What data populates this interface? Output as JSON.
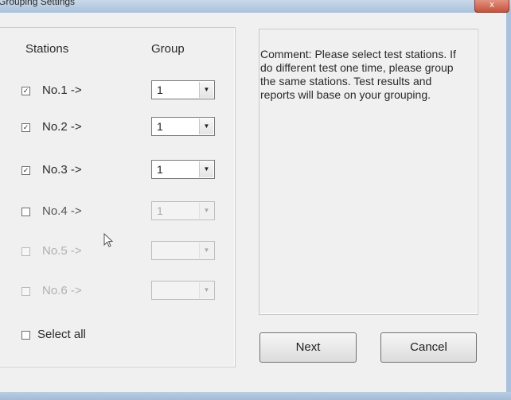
{
  "window": {
    "title": "Grouping Settings",
    "close_glyph": "x"
  },
  "headers": {
    "stations": "Stations",
    "group": "Group"
  },
  "stations": [
    {
      "label": "No.1 ->",
      "checked": true,
      "check_glyph": "✓",
      "group": "1",
      "enabled": true
    },
    {
      "label": "No.2 ->",
      "checked": true,
      "check_glyph": "✓",
      "group": "1",
      "enabled": true
    },
    {
      "label": "No.3 ->",
      "checked": true,
      "check_glyph": "✓",
      "group": "1",
      "enabled": true
    },
    {
      "label": "No.4 ->",
      "checked": false,
      "check_glyph": "",
      "group": "1",
      "enabled": false
    },
    {
      "label": "No.5 ->",
      "checked": false,
      "check_glyph": "",
      "group": "",
      "enabled": false
    },
    {
      "label": "No.6 ->",
      "checked": false,
      "check_glyph": "",
      "group": "",
      "enabled": false
    }
  ],
  "select_all": {
    "label": "Select all",
    "checked": false
  },
  "comment": "Comment: Please select test stations. If do different test one time, please group the same stations. Test results and reports will base on your grouping.",
  "buttons": {
    "next": "Next",
    "cancel": "Cancel"
  },
  "combo_arrow_glyph": "▼",
  "colors": {
    "frame": "#a9c1dc",
    "client": "#f0f0f0",
    "disabled_text": "#b0b0b0"
  }
}
